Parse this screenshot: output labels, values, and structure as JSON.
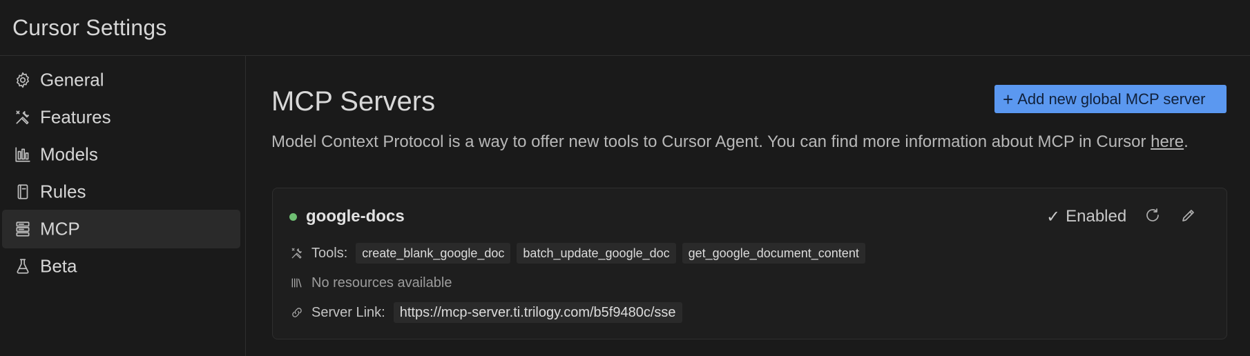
{
  "app": {
    "title": "Cursor Settings"
  },
  "sidebar": {
    "items": [
      {
        "label": "General",
        "icon": "gear-icon",
        "active": false
      },
      {
        "label": "Features",
        "icon": "tools-icon",
        "active": false
      },
      {
        "label": "Models",
        "icon": "bar-chart-icon",
        "active": false
      },
      {
        "label": "Rules",
        "icon": "book-icon",
        "active": false
      },
      {
        "label": "MCP",
        "icon": "server-icon",
        "active": true
      },
      {
        "label": "Beta",
        "icon": "flask-icon",
        "active": false
      }
    ]
  },
  "main": {
    "title": "MCP Servers",
    "add_button": {
      "plus": "+",
      "label": "Add new global MCP server"
    },
    "description": {
      "text": "Model Context Protocol is a way to offer new tools to Cursor Agent. You can find more information about MCP in Cursor ",
      "link_text": "here",
      "suffix": "."
    },
    "server": {
      "name": "google-docs",
      "status_color": "#6fbf73",
      "enabled_check": "✓",
      "enabled_label": "Enabled",
      "tools_label": "Tools:",
      "tools": [
        "create_blank_google_doc",
        "batch_update_google_doc",
        "get_google_document_content"
      ],
      "resources_text": "No resources available",
      "server_link_label": "Server Link:",
      "server_link": "https://mcp-server.ti.trilogy.com/b5f9480c/sse"
    }
  },
  "colors": {
    "background": "#1a1a1a",
    "accent": "#5b98f0",
    "active_nav": "#2a2a2a",
    "status_ok": "#6fbf73"
  }
}
